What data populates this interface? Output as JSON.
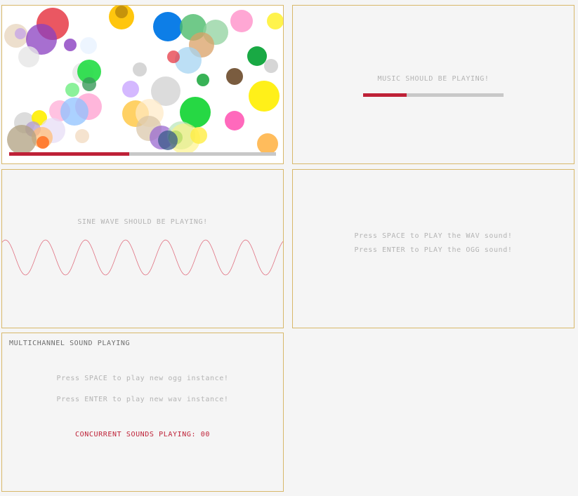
{
  "colors": {
    "panel_border": "#d8b86a",
    "background": "#f5f5f5",
    "text_gray": "#b4b4b4",
    "accent_red": "#be2137",
    "track_gray": "#c8c8c8"
  },
  "bubbles_panel": {
    "music_progress": 0.45
  },
  "music_panel": {
    "message": "MUSIC SHOULD BE PLAYING!",
    "music_progress": 0.31
  },
  "sine_panel": {
    "message": "SINE WAVE SHOULD BE PLAYING!",
    "wave_color": "#e07080"
  },
  "sound_panel": {
    "line1": "Press SPACE to PLAY the WAV sound!",
    "line2": "Press ENTER to PLAY the OGG sound!"
  },
  "multichannel_panel": {
    "title": "MULTICHANNEL SOUND PLAYING",
    "line1": "Press SPACE to play new ogg instance!",
    "line2": "Press ENTER to play new wav instance!",
    "counter_text": "CONCURRENT SOUNDS PLAYING: 00"
  }
}
